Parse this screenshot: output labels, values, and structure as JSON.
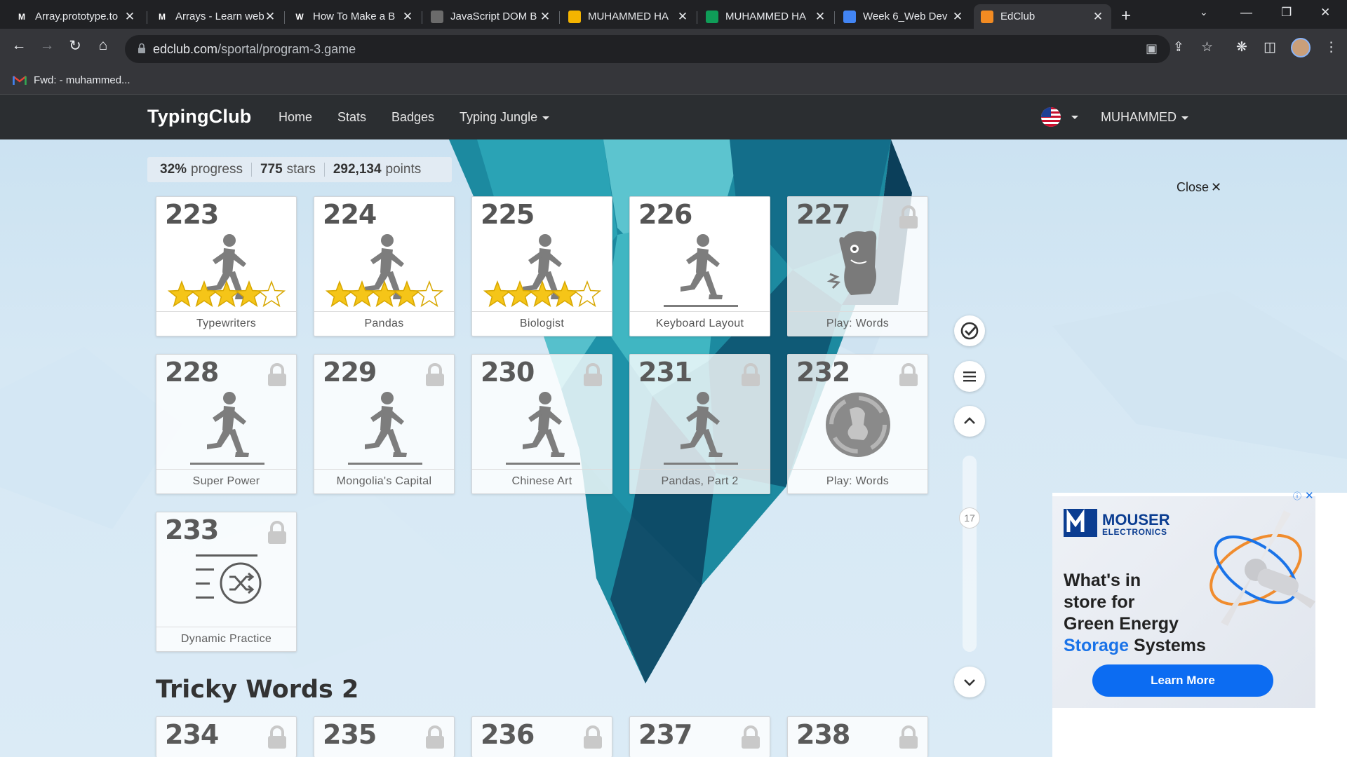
{
  "browser": {
    "tabs": [
      {
        "title": "Array.prototype.to",
        "favicon": "M",
        "fav_color": "#202124",
        "active": false
      },
      {
        "title": "Arrays - Learn web",
        "favicon": "M",
        "fav_color": "#202124",
        "active": false
      },
      {
        "title": "How To Make a B",
        "favicon": "W",
        "fav_color": "#202124",
        "active": false
      },
      {
        "title": "JavaScript DOM B",
        "favicon": "",
        "fav_color": "#6b6b6b",
        "active": false
      },
      {
        "title": "MUHAMMED HA",
        "favicon": "",
        "fav_color": "#f4b400",
        "active": false
      },
      {
        "title": "MUHAMMED HA",
        "favicon": "",
        "fav_color": "#0f9d58",
        "active": false
      },
      {
        "title": "Week 6_Web Dev",
        "favicon": "",
        "fav_color": "#4285f4",
        "active": false
      },
      {
        "title": "EdClub",
        "favicon": "",
        "fav_color": "#f28b22",
        "active": true
      }
    ],
    "url_host": "edclub.com",
    "url_path": "/sportal/program-3.game",
    "bookmark": "Fwd: - muhammed..."
  },
  "nav": {
    "brand": "TypingClub",
    "links": [
      "Home",
      "Stats",
      "Badges",
      "Typing Jungle"
    ],
    "user": "MUHAMMED"
  },
  "progress": {
    "percent": "32%",
    "percent_label": "progress",
    "stars": "775",
    "stars_label": "stars",
    "points": "292,134",
    "points_label": "points"
  },
  "close_label": "Close",
  "lessons": [
    {
      "num": "223",
      "label": "Typewriters",
      "locked": false,
      "art": "runner",
      "stars": 4
    },
    {
      "num": "224",
      "label": "Pandas",
      "locked": false,
      "art": "runner",
      "stars": 4
    },
    {
      "num": "225",
      "label": "Biologist",
      "locked": false,
      "art": "runner",
      "stars": 4
    },
    {
      "num": "226",
      "label": "Keyboard Layout",
      "locked": false,
      "art": "runner",
      "stars": 0
    },
    {
      "num": "227",
      "label": "Play: Words",
      "locked": true,
      "art": "monster",
      "stars": 0
    },
    {
      "num": "228",
      "label": "Super Power",
      "locked": true,
      "art": "runner",
      "stars": 0
    },
    {
      "num": "229",
      "label": "Mongolia's Capital",
      "locked": true,
      "art": "runner",
      "stars": 0
    },
    {
      "num": "230",
      "label": "Chinese Art",
      "locked": true,
      "art": "runner",
      "stars": 0
    },
    {
      "num": "231",
      "label": "Pandas, Part 2",
      "locked": true,
      "art": "runner",
      "stars": 0
    },
    {
      "num": "232",
      "label": "Play: Words",
      "locked": true,
      "art": "game",
      "stars": 0
    },
    {
      "num": "233",
      "label": "Dynamic Practice",
      "locked": true,
      "art": "shuffle",
      "stars": 0
    }
  ],
  "section": {
    "title": "Tricky Words 2",
    "lessons": [
      "234",
      "235",
      "236",
      "237",
      "238"
    ]
  },
  "sidebar": {
    "position": "17"
  },
  "ad": {
    "brand": "MOUSER",
    "brand_sub": "ELECTRONICS",
    "line1": "What's in",
    "line2": "store for",
    "line3": "Green Energy",
    "line4_blue": "Storage",
    "line4_rest": " Systems",
    "cta": "Learn More"
  },
  "colors": {
    "accent": "#2b2e31",
    "star": "#f5c518",
    "ad_cta": "#0c6cf2"
  }
}
